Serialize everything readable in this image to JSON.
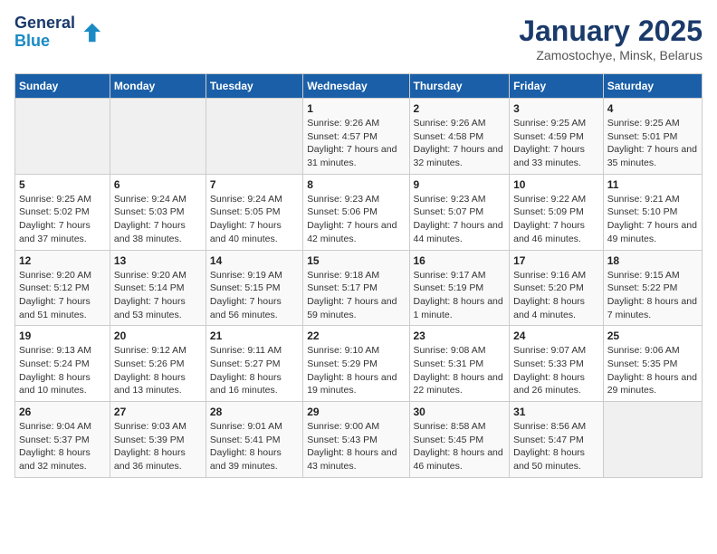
{
  "header": {
    "logo_line1": "General",
    "logo_line2": "Blue",
    "title": "January 2025",
    "subtitle": "Zamostochye, Minsk, Belarus"
  },
  "weekdays": [
    "Sunday",
    "Monday",
    "Tuesday",
    "Wednesday",
    "Thursday",
    "Friday",
    "Saturday"
  ],
  "weeks": [
    [
      {
        "day": "",
        "sunrise": "",
        "sunset": "",
        "daylight": "",
        "empty": true
      },
      {
        "day": "",
        "sunrise": "",
        "sunset": "",
        "daylight": "",
        "empty": true
      },
      {
        "day": "",
        "sunrise": "",
        "sunset": "",
        "daylight": "",
        "empty": true
      },
      {
        "day": "1",
        "sunrise": "Sunrise: 9:26 AM",
        "sunset": "Sunset: 4:57 PM",
        "daylight": "Daylight: 7 hours and 31 minutes."
      },
      {
        "day": "2",
        "sunrise": "Sunrise: 9:26 AM",
        "sunset": "Sunset: 4:58 PM",
        "daylight": "Daylight: 7 hours and 32 minutes."
      },
      {
        "day": "3",
        "sunrise": "Sunrise: 9:25 AM",
        "sunset": "Sunset: 4:59 PM",
        "daylight": "Daylight: 7 hours and 33 minutes."
      },
      {
        "day": "4",
        "sunrise": "Sunrise: 9:25 AM",
        "sunset": "Sunset: 5:01 PM",
        "daylight": "Daylight: 7 hours and 35 minutes."
      }
    ],
    [
      {
        "day": "5",
        "sunrise": "Sunrise: 9:25 AM",
        "sunset": "Sunset: 5:02 PM",
        "daylight": "Daylight: 7 hours and 37 minutes."
      },
      {
        "day": "6",
        "sunrise": "Sunrise: 9:24 AM",
        "sunset": "Sunset: 5:03 PM",
        "daylight": "Daylight: 7 hours and 38 minutes."
      },
      {
        "day": "7",
        "sunrise": "Sunrise: 9:24 AM",
        "sunset": "Sunset: 5:05 PM",
        "daylight": "Daylight: 7 hours and 40 minutes."
      },
      {
        "day": "8",
        "sunrise": "Sunrise: 9:23 AM",
        "sunset": "Sunset: 5:06 PM",
        "daylight": "Daylight: 7 hours and 42 minutes."
      },
      {
        "day": "9",
        "sunrise": "Sunrise: 9:23 AM",
        "sunset": "Sunset: 5:07 PM",
        "daylight": "Daylight: 7 hours and 44 minutes."
      },
      {
        "day": "10",
        "sunrise": "Sunrise: 9:22 AM",
        "sunset": "Sunset: 5:09 PM",
        "daylight": "Daylight: 7 hours and 46 minutes."
      },
      {
        "day": "11",
        "sunrise": "Sunrise: 9:21 AM",
        "sunset": "Sunset: 5:10 PM",
        "daylight": "Daylight: 7 hours and 49 minutes."
      }
    ],
    [
      {
        "day": "12",
        "sunrise": "Sunrise: 9:20 AM",
        "sunset": "Sunset: 5:12 PM",
        "daylight": "Daylight: 7 hours and 51 minutes."
      },
      {
        "day": "13",
        "sunrise": "Sunrise: 9:20 AM",
        "sunset": "Sunset: 5:14 PM",
        "daylight": "Daylight: 7 hours and 53 minutes."
      },
      {
        "day": "14",
        "sunrise": "Sunrise: 9:19 AM",
        "sunset": "Sunset: 5:15 PM",
        "daylight": "Daylight: 7 hours and 56 minutes."
      },
      {
        "day": "15",
        "sunrise": "Sunrise: 9:18 AM",
        "sunset": "Sunset: 5:17 PM",
        "daylight": "Daylight: 7 hours and 59 minutes."
      },
      {
        "day": "16",
        "sunrise": "Sunrise: 9:17 AM",
        "sunset": "Sunset: 5:19 PM",
        "daylight": "Daylight: 8 hours and 1 minute."
      },
      {
        "day": "17",
        "sunrise": "Sunrise: 9:16 AM",
        "sunset": "Sunset: 5:20 PM",
        "daylight": "Daylight: 8 hours and 4 minutes."
      },
      {
        "day": "18",
        "sunrise": "Sunrise: 9:15 AM",
        "sunset": "Sunset: 5:22 PM",
        "daylight": "Daylight: 8 hours and 7 minutes."
      }
    ],
    [
      {
        "day": "19",
        "sunrise": "Sunrise: 9:13 AM",
        "sunset": "Sunset: 5:24 PM",
        "daylight": "Daylight: 8 hours and 10 minutes."
      },
      {
        "day": "20",
        "sunrise": "Sunrise: 9:12 AM",
        "sunset": "Sunset: 5:26 PM",
        "daylight": "Daylight: 8 hours and 13 minutes."
      },
      {
        "day": "21",
        "sunrise": "Sunrise: 9:11 AM",
        "sunset": "Sunset: 5:27 PM",
        "daylight": "Daylight: 8 hours and 16 minutes."
      },
      {
        "day": "22",
        "sunrise": "Sunrise: 9:10 AM",
        "sunset": "Sunset: 5:29 PM",
        "daylight": "Daylight: 8 hours and 19 minutes."
      },
      {
        "day": "23",
        "sunrise": "Sunrise: 9:08 AM",
        "sunset": "Sunset: 5:31 PM",
        "daylight": "Daylight: 8 hours and 22 minutes."
      },
      {
        "day": "24",
        "sunrise": "Sunrise: 9:07 AM",
        "sunset": "Sunset: 5:33 PM",
        "daylight": "Daylight: 8 hours and 26 minutes."
      },
      {
        "day": "25",
        "sunrise": "Sunrise: 9:06 AM",
        "sunset": "Sunset: 5:35 PM",
        "daylight": "Daylight: 8 hours and 29 minutes."
      }
    ],
    [
      {
        "day": "26",
        "sunrise": "Sunrise: 9:04 AM",
        "sunset": "Sunset: 5:37 PM",
        "daylight": "Daylight: 8 hours and 32 minutes."
      },
      {
        "day": "27",
        "sunrise": "Sunrise: 9:03 AM",
        "sunset": "Sunset: 5:39 PM",
        "daylight": "Daylight: 8 hours and 36 minutes."
      },
      {
        "day": "28",
        "sunrise": "Sunrise: 9:01 AM",
        "sunset": "Sunset: 5:41 PM",
        "daylight": "Daylight: 8 hours and 39 minutes."
      },
      {
        "day": "29",
        "sunrise": "Sunrise: 9:00 AM",
        "sunset": "Sunset: 5:43 PM",
        "daylight": "Daylight: 8 hours and 43 minutes."
      },
      {
        "day": "30",
        "sunrise": "Sunrise: 8:58 AM",
        "sunset": "Sunset: 5:45 PM",
        "daylight": "Daylight: 8 hours and 46 minutes."
      },
      {
        "day": "31",
        "sunrise": "Sunrise: 8:56 AM",
        "sunset": "Sunset: 5:47 PM",
        "daylight": "Daylight: 8 hours and 50 minutes."
      },
      {
        "day": "",
        "sunrise": "",
        "sunset": "",
        "daylight": "",
        "empty": true
      }
    ]
  ]
}
